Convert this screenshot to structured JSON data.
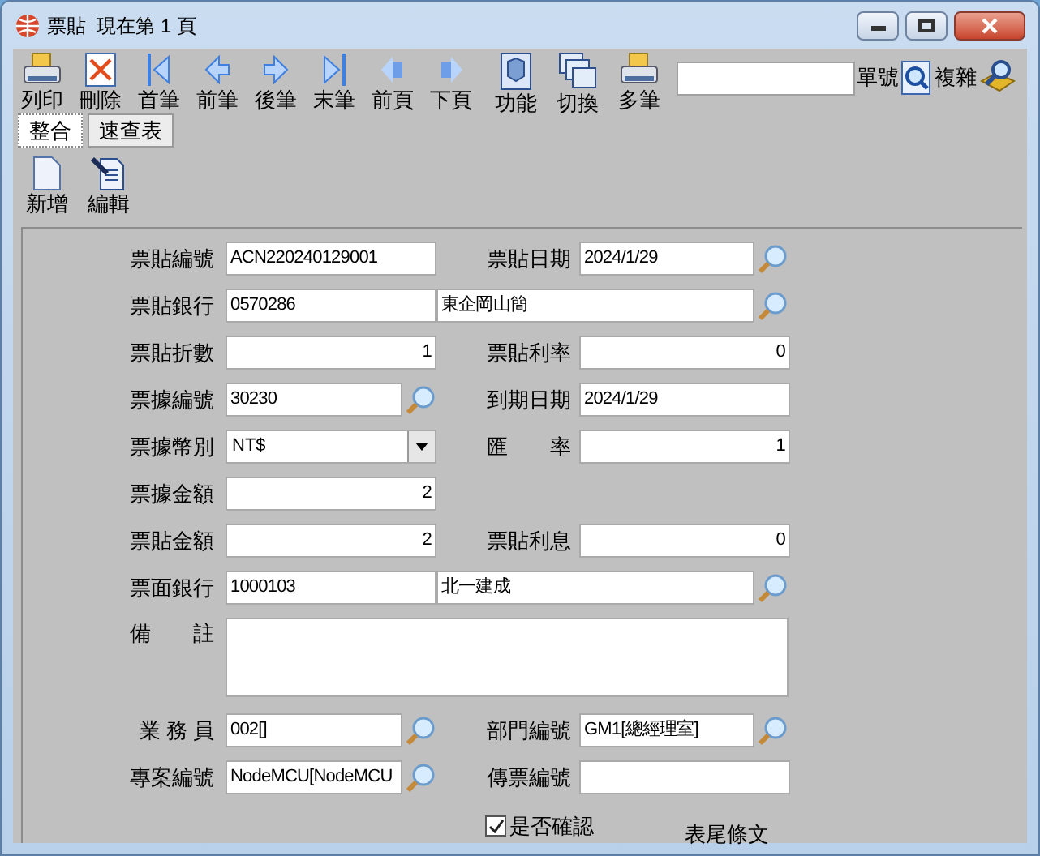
{
  "window": {
    "title": "票貼  現在第 1 頁"
  },
  "toolbar": [
    {
      "label": "列印"
    },
    {
      "label": "刪除"
    },
    {
      "label": "首筆"
    },
    {
      "label": "前筆"
    },
    {
      "label": "後筆"
    },
    {
      "label": "末筆"
    },
    {
      "label": "前頁"
    },
    {
      "label": "下頁"
    },
    {
      "label": "功能"
    },
    {
      "label": "切換"
    },
    {
      "label": "多筆"
    }
  ],
  "search": {
    "label": "單號",
    "button": "複雜"
  },
  "tabs": [
    {
      "label": "整合",
      "selected": true
    },
    {
      "label": "速查表",
      "selected": false
    }
  ],
  "actions": [
    {
      "label": "新增"
    },
    {
      "label": "編輯"
    }
  ],
  "form": {
    "rows": [
      {
        "kind": "pair",
        "label": "票貼編號",
        "value": "ACN220240129001",
        "label2": "票貼日期",
        "value2": "2024/1/29",
        "lookup2": true
      },
      {
        "kind": "bank",
        "label": "票貼銀行",
        "value": "0570286",
        "value2": "東企岡山簡"
      },
      {
        "kind": "pair",
        "label": "票貼折數",
        "value": "1",
        "numeric": true,
        "label2": "票貼利率",
        "value2": "0",
        "numeric2": true
      },
      {
        "kind": "pair",
        "label": "票據編號",
        "value": "30230",
        "lookup": true,
        "label2": "到期日期",
        "value2": "2024/1/29"
      },
      {
        "kind": "pair",
        "label": "票據幣別",
        "value": "NT$",
        "dropdown": true,
        "label2": "匯　　率",
        "value2": "1",
        "numeric2": true
      },
      {
        "kind": "single",
        "label": "票據金額",
        "value": "2",
        "numeric": true
      },
      {
        "kind": "pair",
        "label": "票貼金額",
        "value": "2",
        "numeric": true,
        "label2": "票貼利息",
        "value2": "0",
        "numeric2": true
      },
      {
        "kind": "bank",
        "label": "票面銀行",
        "value": "1000103",
        "value2": "北一建成"
      },
      {
        "kind": "memo",
        "label": "備　　註"
      },
      {
        "kind": "pair",
        "label": "業 務 員",
        "value": "002[]",
        "lookup": true,
        "label2": "部門編號",
        "value2": "GM1[總經理室]",
        "lookup2": true
      },
      {
        "kind": "pair",
        "label": "專案編號",
        "value": "NodeMCU[NodeMCU",
        "lookup": true,
        "label2": "傳票編號"
      }
    ],
    "confirm": {
      "label": "是否確認",
      "checked": true
    },
    "footer_text": "表尾條文"
  }
}
